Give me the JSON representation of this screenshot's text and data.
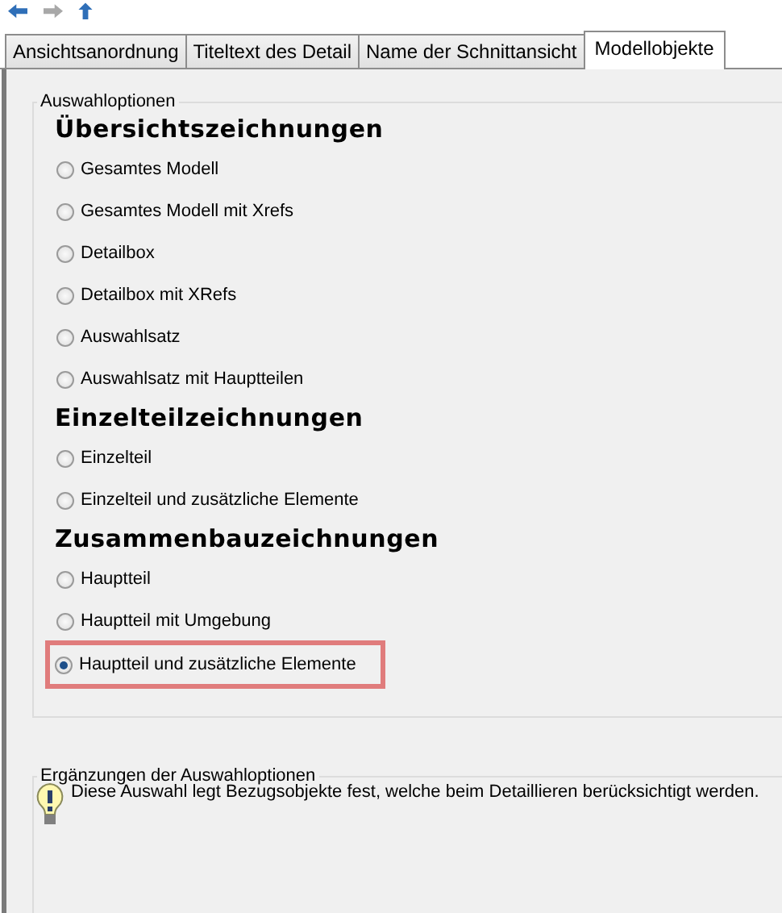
{
  "toolbar": {
    "buttons": [
      {
        "kind": "back",
        "disabled": false
      },
      {
        "kind": "forward",
        "disabled": true
      },
      {
        "kind": "up",
        "disabled": false
      }
    ]
  },
  "tabs": [
    {
      "label": "Ansichtsanordnung",
      "selected": false
    },
    {
      "label": "Titeltext des Detail",
      "selected": false
    },
    {
      "label": "Name der Schnittansicht",
      "selected": false
    },
    {
      "label": "Modellobjekte",
      "selected": true
    }
  ],
  "selection_group": {
    "title": "Auswahloptionen",
    "sections": [
      {
        "heading": "Übersichtszeichnungen",
        "options": [
          {
            "label": "Gesamtes Modell",
            "selected": false,
            "highlighted": false
          },
          {
            "label": "Gesamtes Modell mit Xrefs",
            "selected": false,
            "highlighted": false
          },
          {
            "label": "Detailbox",
            "selected": false,
            "highlighted": false
          },
          {
            "label": "Detailbox mit XRefs",
            "selected": false,
            "highlighted": false
          },
          {
            "label": "Auswahlsatz",
            "selected": false,
            "highlighted": false
          },
          {
            "label": "Auswahlsatz mit Hauptteilen",
            "selected": false,
            "highlighted": false
          }
        ]
      },
      {
        "heading": "Einzelteilzeichnungen",
        "options": [
          {
            "label": "Einzelteil",
            "selected": false,
            "highlighted": false
          },
          {
            "label": "Einzelteil und zusätzliche Elemente",
            "selected": false,
            "highlighted": false
          }
        ]
      },
      {
        "heading": "Zusammenbauzeichnungen",
        "options": [
          {
            "label": "Hauptteil",
            "selected": false,
            "highlighted": false
          },
          {
            "label": "Hauptteil mit Umgebung",
            "selected": false,
            "highlighted": false
          },
          {
            "label": "Hauptteil und zusätzliche Elemente",
            "selected": true,
            "highlighted": true
          }
        ]
      }
    ]
  },
  "info_group": {
    "title": "Ergänzungen der Auswahloptionen",
    "message": "Diese Auswahl legt Bezugsobjekte fest, welche beim Detaillieren berücksichtigt werden."
  }
}
